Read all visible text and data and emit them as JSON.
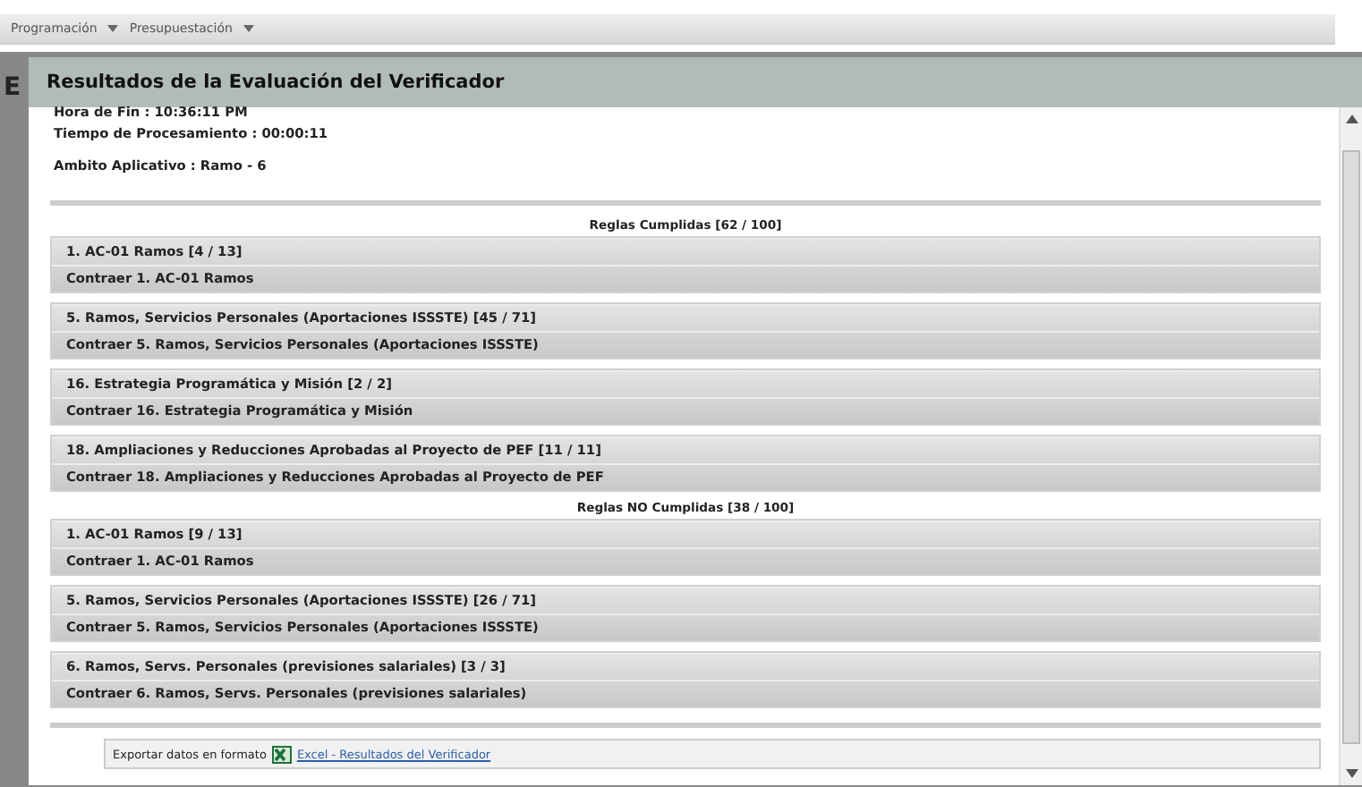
{
  "menu": [
    "Programación",
    "Presupuestación"
  ],
  "background_heading": "E",
  "dialog": {
    "title": "Resultados de la Evaluación del Verificador",
    "info_lines": [
      "Hora de Fin : 10:36:11 PM",
      "Tiempo de Procesamiento : 00:00:11",
      "Ambito Aplicativo : Ramo - 6"
    ],
    "sections": [
      {
        "title": "Reglas Cumplidas [62 / 100]",
        "groups": [
          {
            "title": "1. AC-01 Ramos [4 / 13]",
            "collapse": "Contraer 1. AC-01 Ramos"
          },
          {
            "title": "5. Ramos, Servicios Personales (Aportaciones ISSSTE) [45 / 71]",
            "collapse": "Contraer 5. Ramos, Servicios Personales (Aportaciones ISSSTE)"
          },
          {
            "title": "16. Estrategia Programática y Misión [2 / 2]",
            "collapse": "Contraer 16. Estrategia Programática y Misión"
          },
          {
            "title": "18. Ampliaciones y Reducciones Aprobadas al Proyecto de PEF [11 / 11]",
            "collapse": "Contraer 18. Ampliaciones y Reducciones Aprobadas al Proyecto de PEF"
          }
        ]
      },
      {
        "title": "Reglas NO Cumplidas [38 / 100]",
        "groups": [
          {
            "title": "1. AC-01 Ramos [9 / 13]",
            "collapse": "Contraer 1. AC-01 Ramos"
          },
          {
            "title": "5. Ramos, Servicios Personales (Aportaciones ISSSTE) [26 / 71]",
            "collapse": "Contraer 5. Ramos, Servicios Personales (Aportaciones ISSSTE)"
          },
          {
            "title": "6. Ramos, Servs. Personales (previsiones salariales) [3 / 3]",
            "collapse": "Contraer 6. Ramos, Servs. Personales (previsiones salariales)"
          }
        ]
      }
    ],
    "export": {
      "label": "Exportar datos en formato",
      "link": "Excel - Resultados del Verificador"
    }
  }
}
